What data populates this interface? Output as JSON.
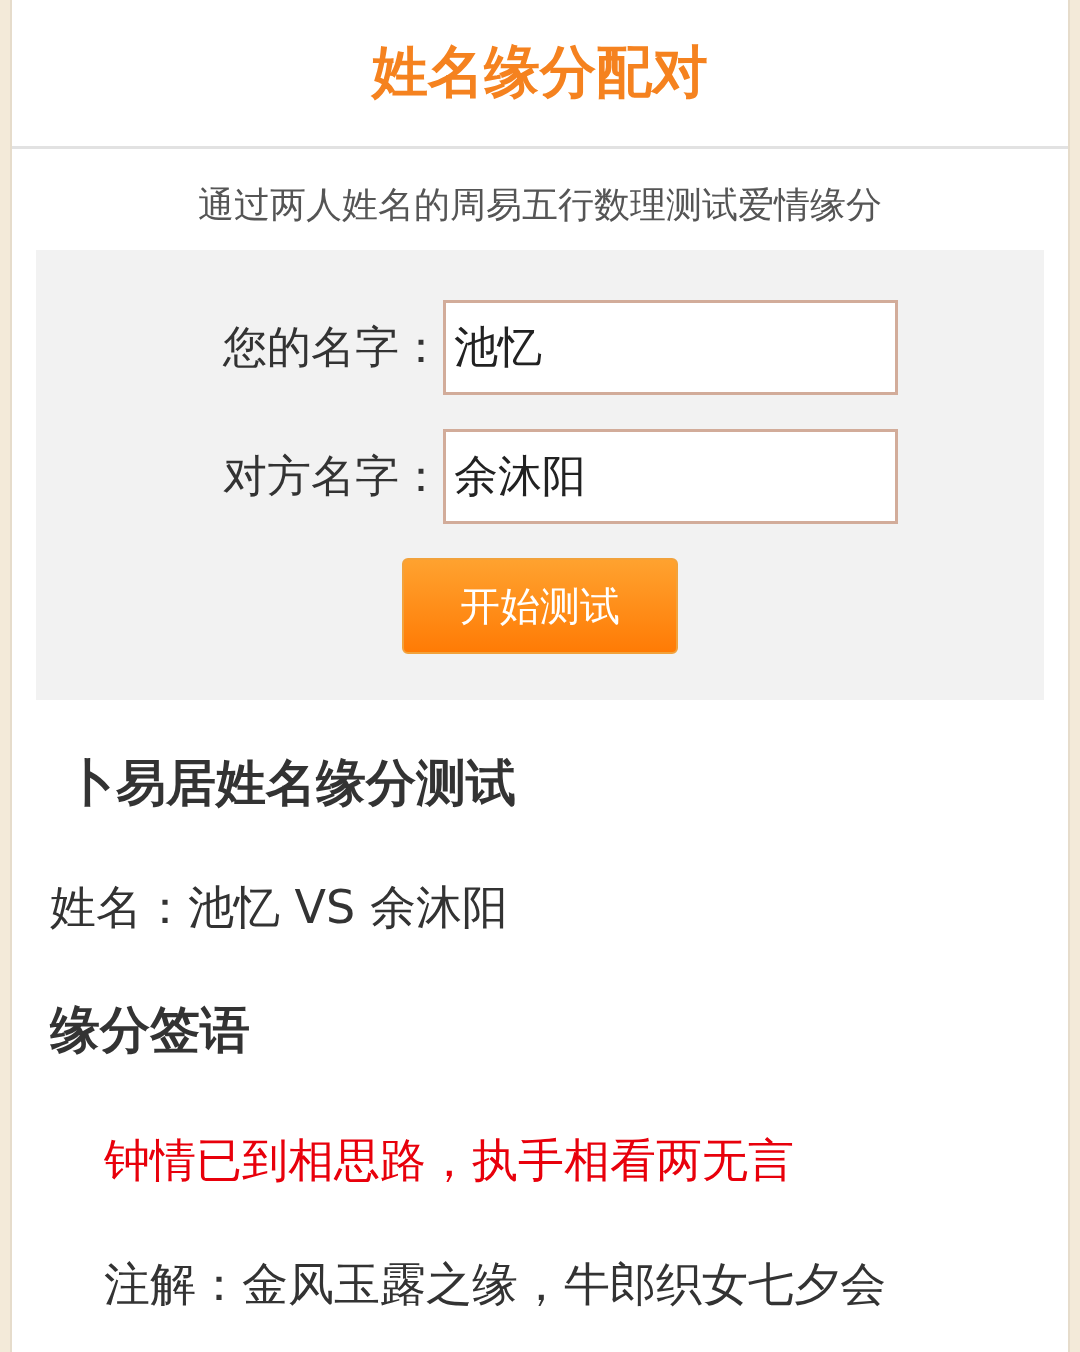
{
  "title": "姓名缘分配对",
  "subtitle": "通过两人姓名的周易五行数理测试爱情缘分",
  "form": {
    "fields": [
      {
        "label": "您的名字：",
        "value": "池忆"
      },
      {
        "label": "对方名字：",
        "value": "余沐阳"
      }
    ],
    "button": "开始测试"
  },
  "result": {
    "heading": "卜易居姓名缘分测试",
    "names": "姓名：池忆 VS 余沐阳",
    "section": "缘分签语",
    "verse": "钟情已到相思路，执手相看两无言",
    "note": "注解：金风玉露之缘，牛郎织女七夕会"
  }
}
